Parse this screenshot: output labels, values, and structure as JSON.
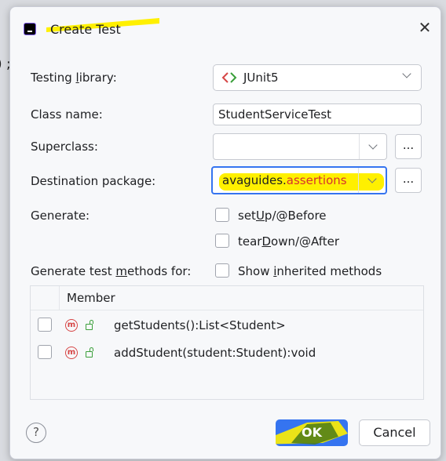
{
  "background": {
    "text": ") ;"
  },
  "dialog": {
    "title": "Create Test",
    "testing_library": {
      "label_pre": "Testing ",
      "label_u": "l",
      "label_post": "ibrary:",
      "value": "JUnit5"
    },
    "class_name": {
      "label": "Class name:",
      "value": "StudentServiceTest"
    },
    "superclass": {
      "label": "Superclass:",
      "value": "",
      "browse": "..."
    },
    "destination_package": {
      "label": "Destination package:",
      "value_part1": "avaguides.",
      "value_part2": "assertions",
      "browse": "..."
    },
    "generate": {
      "label": "Generate:",
      "setup": {
        "pre": "set",
        "u": "U",
        "post": "p/@Before"
      },
      "teardown": {
        "pre": "tear",
        "u": "D",
        "post": "own/@After"
      }
    },
    "methods_for": {
      "pre": "Generate test ",
      "u": "m",
      "post": "ethods for:"
    },
    "show_inherited": {
      "pre": "Show ",
      "u": "i",
      "post": "nherited methods"
    },
    "member_table": {
      "header": "Member",
      "rows": [
        {
          "icon": "m",
          "signature": "getStudents():List<Student>"
        },
        {
          "icon": "m",
          "signature": "addStudent(student:Student):void"
        }
      ]
    },
    "help": "?",
    "ok": "OK",
    "cancel": "Cancel"
  },
  "colors": {
    "accent": "#3574f0",
    "highlight": "#fff000",
    "error_text": "#d6322e",
    "method_icon": "#d64545"
  }
}
